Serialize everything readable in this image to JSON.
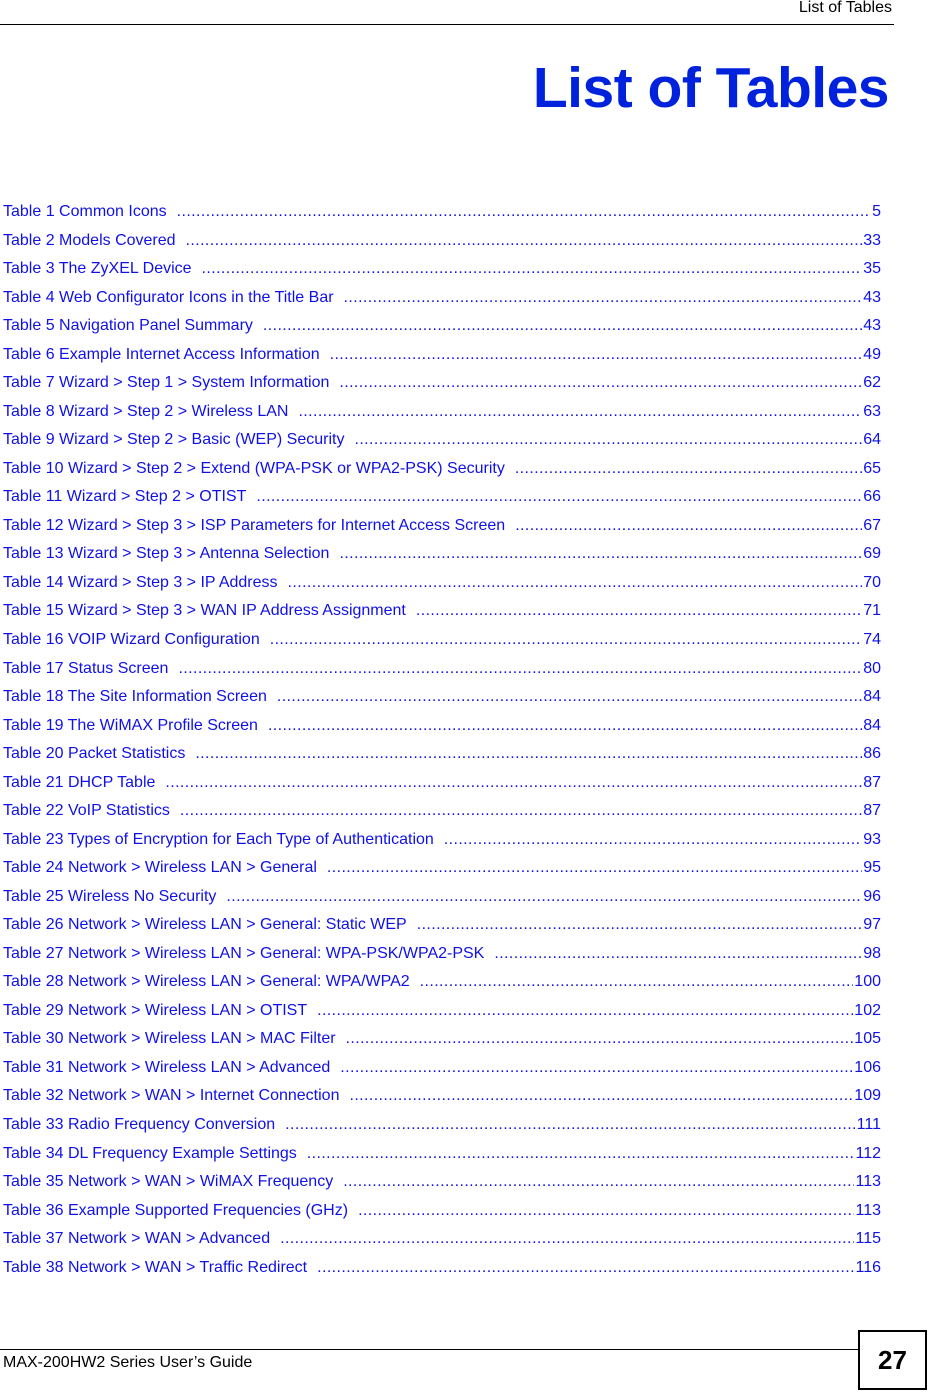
{
  "header": {
    "running_title": "List of Tables"
  },
  "page_title": "List of Tables",
  "colors": {
    "title": "#0022dd",
    "link": "#1010e8",
    "text": "#000000"
  },
  "entries": [
    {
      "label": "Table 1 Common Icons",
      "page": "5"
    },
    {
      "label": "Table 2 Models Covered",
      "page": "33"
    },
    {
      "label": "Table 3 The ZyXEL Device",
      "page": "35"
    },
    {
      "label": "Table 4 Web Configurator Icons in the Title Bar",
      "page": "43"
    },
    {
      "label": "Table 5 Navigation Panel Summary",
      "page": "43"
    },
    {
      "label": "Table 6 Example Internet Access Information",
      "page": "49"
    },
    {
      "label": "Table 7 Wizard > Step 1 > System Information",
      "page": "62"
    },
    {
      "label": "Table 8 Wizard > Step 2 > Wireless LAN",
      "page": "63"
    },
    {
      "label": "Table 9 Wizard > Step 2 > Basic (WEP) Security",
      "page": "64"
    },
    {
      "label": "Table 10 Wizard > Step 2 > Extend (WPA-PSK or WPA2-PSK) Security",
      "page": "65"
    },
    {
      "label": "Table 11 Wizard > Step 2 > OTIST",
      "page": "66"
    },
    {
      "label": "Table 12 Wizard > Step 3 > ISP Parameters for Internet Access Screen",
      "page": "67"
    },
    {
      "label": "Table 13 Wizard > Step 3 > Antenna Selection",
      "page": "69"
    },
    {
      "label": "Table 14 Wizard > Step 3 > IP Address",
      "page": "70"
    },
    {
      "label": "Table 15 Wizard > Step 3 > WAN IP Address Assignment",
      "page": "71"
    },
    {
      "label": "Table 16 VOIP Wizard Configuration",
      "page": "74"
    },
    {
      "label": "Table 17 Status Screen",
      "page": "80"
    },
    {
      "label": "Table 18 The Site Information Screen",
      "page": "84"
    },
    {
      "label": "Table 19 The WiMAX Profile Screen",
      "page": "84"
    },
    {
      "label": "Table 20 Packet Statistics",
      "page": "86"
    },
    {
      "label": "Table 21 DHCP Table",
      "page": "87"
    },
    {
      "label": "Table 22 VoIP Statistics",
      "page": "87"
    },
    {
      "label": "Table 23 Types of Encryption for Each Type of Authentication",
      "page": "93"
    },
    {
      "label": "Table 24 Network > Wireless LAN > General",
      "page": "95"
    },
    {
      "label": "Table 25 Wireless No Security",
      "page": "96"
    },
    {
      "label": "Table 26 Network > Wireless LAN > General: Static WEP",
      "page": "97"
    },
    {
      "label": "Table 27 Network > Wireless LAN > General: WPA-PSK/WPA2-PSK",
      "page": "98"
    },
    {
      "label": "Table 28 Network > Wireless LAN > General: WPA/WPA2",
      "page": "100"
    },
    {
      "label": "Table 29 Network > Wireless LAN > OTIST",
      "page": "102"
    },
    {
      "label": "Table 30 Network > Wireless LAN > MAC Filter",
      "page": "105"
    },
    {
      "label": "Table 31 Network > Wireless LAN > Advanced",
      "page": "106"
    },
    {
      "label": "Table 32 Network > WAN > Internet Connection",
      "page": "109"
    },
    {
      "label": "Table 33 Radio Frequency Conversion",
      "page": "111"
    },
    {
      "label": "Table 34 DL Frequency Example Settings",
      "page": "112"
    },
    {
      "label": "Table 35 Network > WAN > WiMAX Frequency",
      "page": "113"
    },
    {
      "label": "Table 36 Example Supported Frequencies (GHz)",
      "page": "113"
    },
    {
      "label": "Table 37 Network > WAN > Advanced",
      "page": "115"
    },
    {
      "label": "Table 38 Network > WAN > Traffic Redirect",
      "page": "116"
    }
  ],
  "footer": {
    "guide_title": "MAX-200HW2 Series User’s Guide",
    "page_number": "27"
  }
}
